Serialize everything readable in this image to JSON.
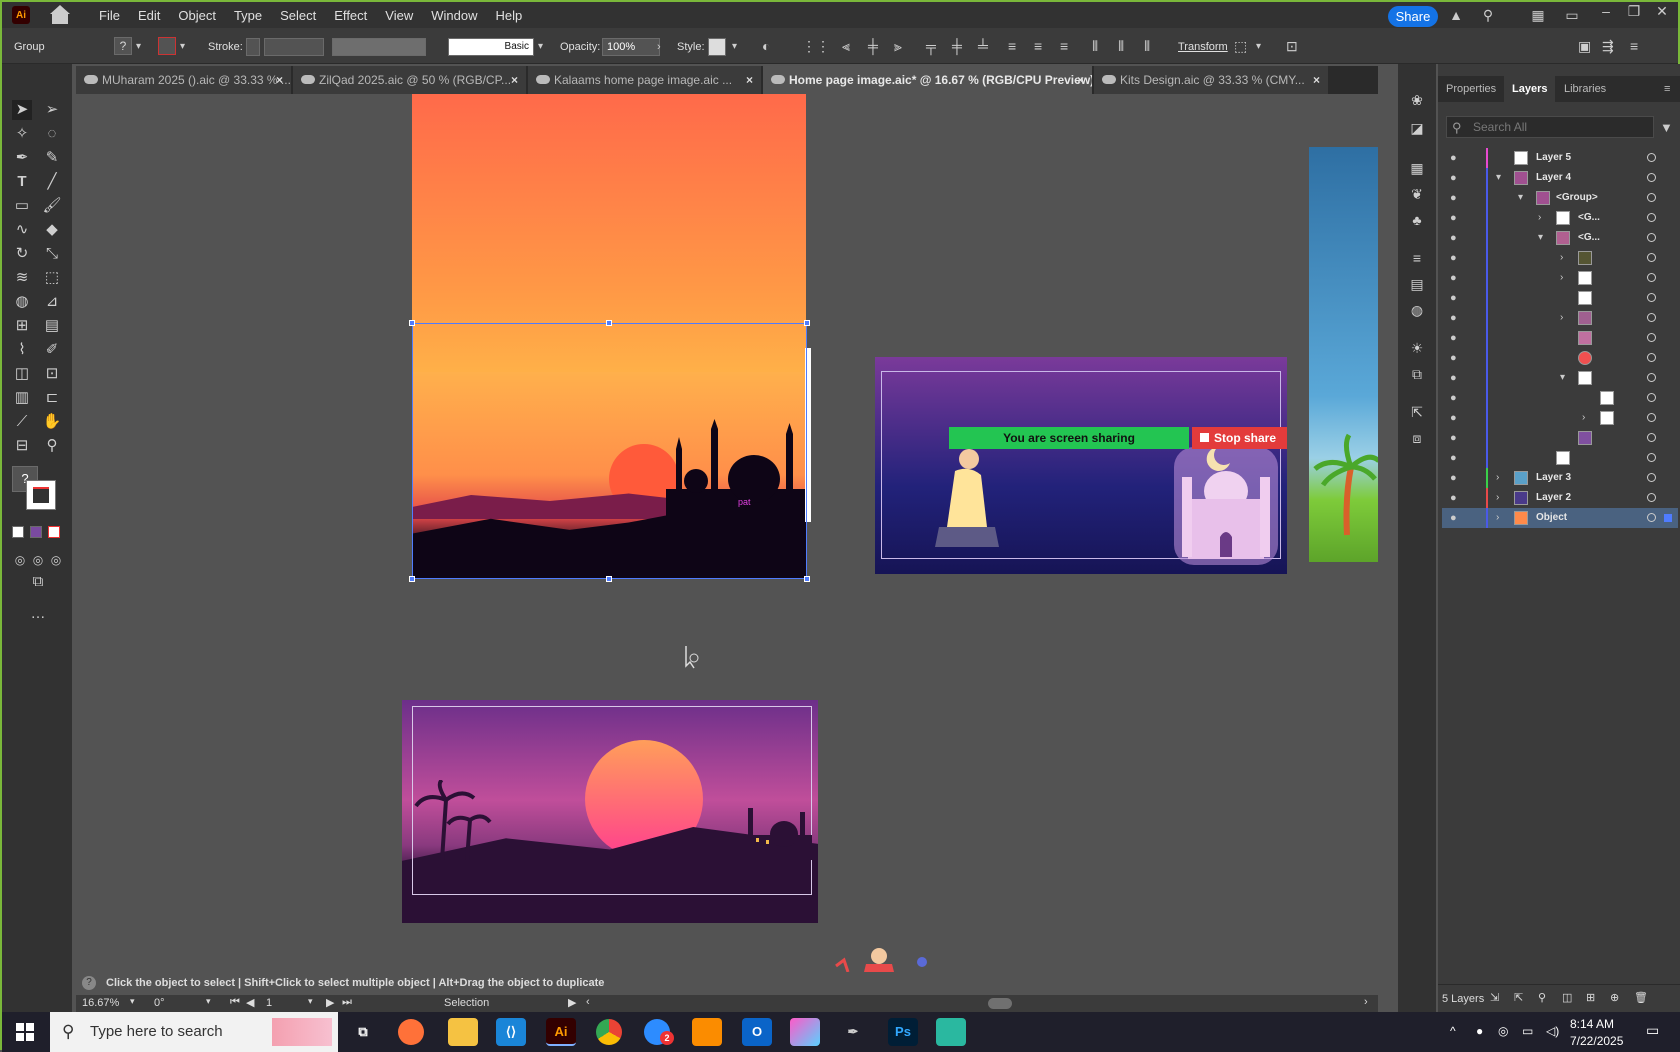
{
  "app": {
    "logo": "Ai",
    "menus": [
      "File",
      "Edit",
      "Object",
      "Type",
      "Select",
      "Effect",
      "View",
      "Window",
      "Help"
    ],
    "share_label": "Share"
  },
  "control": {
    "selection_type": "Group",
    "stroke_label": "Stroke:",
    "brush": "Basic",
    "opacity_label": "Opacity:",
    "opacity_value": "100%",
    "style_label": "Style:",
    "transform_label": "Transform",
    "question": "?"
  },
  "tabs": [
    {
      "label": "MUharam 2025 ().aic @ 33.33 % ..."
    },
    {
      "label": "ZilQad 2025.aic @ 50 % (RGB/CP..."
    },
    {
      "label": "Kalaams home page image.aic ..."
    },
    {
      "label": "Home page image.aic* @ 16.67 % (RGB/CPU Preview)"
    },
    {
      "label": "Kits Design.aic @ 33.33 % (CMY..."
    }
  ],
  "close": "×",
  "canvas": {
    "text_pat": "pat",
    "share_notice": "You are screen sharing",
    "stop_share": "Stop share"
  },
  "status": {
    "hint": "Click the object to select  |  Shift+Click to select multiple object  |  Alt+Drag the object to duplicate",
    "zoom": "16.67%",
    "angle": "0°",
    "artboard": "1",
    "tool": "Selection"
  },
  "panel": {
    "tabs": [
      "Properties",
      "Layers",
      "Libraries"
    ],
    "search_placeholder": "Search All",
    "layers_count": "5 Layers",
    "rows": [
      {
        "name": "Layer 5",
        "color": "#e84ad0"
      },
      {
        "name": "Layer 4",
        "color": "#4a5ae8"
      },
      {
        "name": "<Group>",
        "color": "#4a5ae8"
      },
      {
        "name": "<G...",
        "color": "#4a5ae8"
      },
      {
        "name": "<G...",
        "color": "#4a5ae8"
      },
      {
        "name": "Layer 3",
        "color": "#3ad04a"
      },
      {
        "name": "Layer 2",
        "color": "#e84a4a"
      },
      {
        "name": "Object",
        "color": "#4a5ae8"
      }
    ]
  },
  "taskbar": {
    "search_placeholder": "Type here to search",
    "time": "8:14 AM",
    "date": "7/22/2025",
    "badge": "2"
  }
}
